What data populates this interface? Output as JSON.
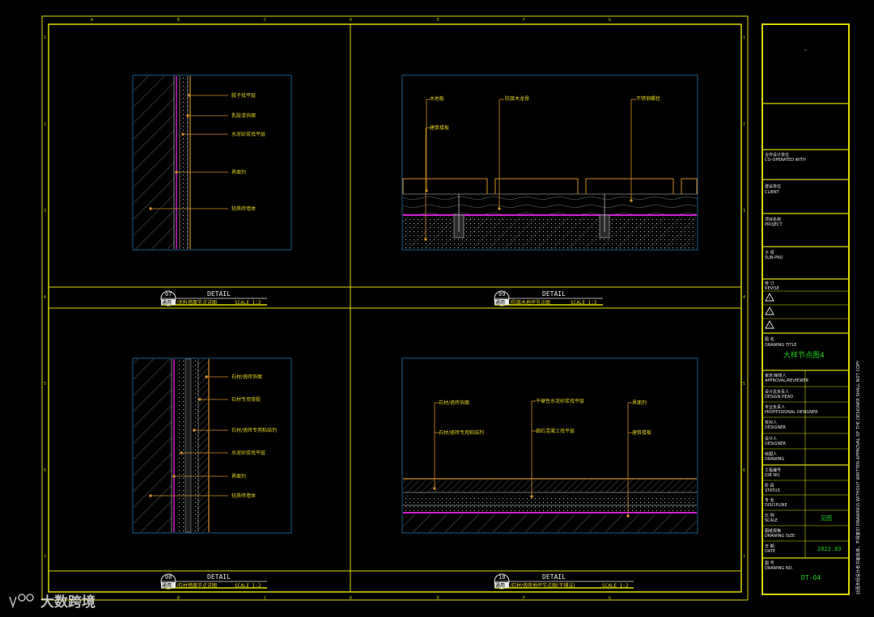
{
  "colors": {
    "frame": "#d8d800",
    "grid": "#e6e600",
    "panel_border": "#1d5c8a",
    "leader": "#d08c28",
    "magenta": "#d020d0",
    "label": "#e0d020",
    "white": "#e8e8e8",
    "green": "#20d020",
    "grey": "#8a8a8a"
  },
  "grid": {
    "cols": [
      "A",
      "B",
      "C",
      "D",
      "E",
      "F",
      "G"
    ],
    "rows": [
      "1",
      "2",
      "3",
      "4",
      "5",
      "6",
      "7"
    ]
  },
  "details": [
    {
      "num": "07",
      "title": "DETAIL",
      "sub_prefix": "通用",
      "sub_name": "/涂料墙面节点详图",
      "scale": "SCALE 1:2",
      "labels": [
        "腻子找平层",
        "乳胶漆饰面",
        "水泥砂浆找平层",
        "界面剂",
        "轻质砖墙体"
      ]
    },
    {
      "num": "09",
      "title": "DETAIL",
      "sub_prefix": "通用",
      "sub_name": "/防腐木地坪节点图",
      "scale": "SCALE 1:2",
      "labels": [
        "木地板",
        "防腐木龙骨",
        "不锈钢螺栓",
        "建筑楼板"
      ]
    },
    {
      "num": "08",
      "title": "DETAIL",
      "sub_prefix": "通用",
      "sub_name": "/石材墙面节点详图",
      "scale": "SCALE 1:2",
      "labels": [
        "石材/瓷砖饰面",
        "石材专用背胶",
        "石材/瓷砖专用粘结剂",
        "水泥砂浆找平层",
        "界面剂",
        "轻质砖墙体"
      ]
    },
    {
      "num": "10",
      "title": "DETAIL",
      "sub_prefix": "通用",
      "sub_name": "/石材/瓷砖地坪节点图(干铺法)",
      "scale": "SCALE 1:2",
      "labels": [
        "石材/瓷砖饰面",
        "干硬性水泥砂浆找平层",
        "界面剂",
        "石材/瓷砖专用粘结剂",
        "细石混凝土找平层",
        "建筑楼板"
      ]
    }
  ],
  "title_block": {
    "top_mark": "-",
    "cooperated_cn": "合作设计单位",
    "cooperated_en": "CO-OPERATED WITH",
    "client_cn": "建设单位",
    "client_en": "CLIENT",
    "project_cn": "项目名称",
    "project_en": "PROJECT",
    "subproj_cn": "子 项",
    "subproj_en": "SUB-PRO",
    "revise_cn": "修 订",
    "revise_en": "REVISE",
    "drawing_title_cn": "图 名",
    "drawing_title_en": "DRAWING TITLE",
    "drawing_title": "大样节点图4",
    "approval_cn": "审定/审核人",
    "approval_en": "APPROVAL/REVIEWER",
    "design_head_cn": "设计总负责人",
    "design_head_en": "DESIGN HEAD",
    "specialty_cn": "专业负责人",
    "specialty_en": "PROFESSIONAL DESIGNER",
    "checker_cn": "校对人",
    "checker_en": "DESIGNER",
    "designer_cn": "设计人",
    "designer_en": "DESIGNER",
    "drawing_cn": "绘图人",
    "drawing_en": "DRAWING",
    "job_cn": "工程编号",
    "job_en": "JOB NO.",
    "status_cn": "阶 段",
    "status_en": "STATUS",
    "discipline_cn": "专 业",
    "discipline_en": "DISCIPLINE",
    "scale_cn": "比 例",
    "scale_en": "SCALE",
    "scale_value": "见图",
    "size_cn": "图纸规格",
    "size_en": "DRAWING SIZE",
    "date_cn": "日 期",
    "date_en": "DATE",
    "date_value": "2022.03",
    "dwgno_cn": "图 号",
    "dwgno_en": "DRAWING NO.",
    "dwgno_value": "DT-04"
  },
  "side_note": "此图未经设计者书面批准，不得复印 DRAWINGS WITHOUT WRITTEN APPROVAL OF THE DESIGNER SHALL NOT COPY",
  "watermark": "大数跨境"
}
